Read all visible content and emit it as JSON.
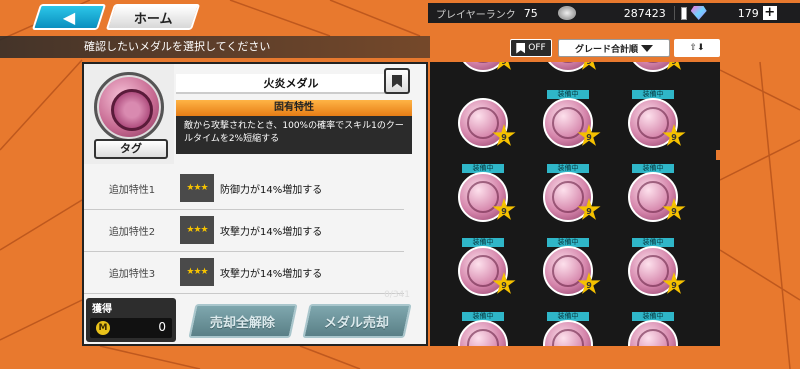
{
  "header": {
    "back_arrow": "◀",
    "home_label": "ホーム"
  },
  "status": {
    "rank_label": "プレイヤーランク",
    "rank_value": "75",
    "coins": "287423",
    "gems": "179",
    "plus": "+"
  },
  "instruction": "確認したいメダルを選択してください",
  "controls": {
    "bookmark_filter": "OFF",
    "sort_label": "グレード合計順",
    "order_toggle": "⇧⬇"
  },
  "medal": {
    "name": "火炎メダル",
    "tag_label": "タグ",
    "unique_header": "固有特性",
    "unique_desc": "敵から攻撃されたとき、100%の確率でスキル1のクールタイムを2%短縮する",
    "traits": [
      {
        "label": "追加特性1",
        "stars": "★★★",
        "text": "防御力が14%増加する"
      },
      {
        "label": "追加特性2",
        "stars": "★★★",
        "text": "攻撃力が14%増加する"
      },
      {
        "label": "追加特性3",
        "stars": "★★★",
        "text": "攻撃力が14%増加する"
      }
    ]
  },
  "bottom": {
    "owned_title": "獲得",
    "coin_letter": "M",
    "owned_value": "0",
    "count": "0/341",
    "unsell_label": "売却全解除",
    "sell_label": "メダル売却"
  },
  "grid": {
    "equip_label": "装備中",
    "grade": "9",
    "cells": [
      {
        "equipped": false
      },
      {
        "equipped": false
      },
      {
        "equipped": false
      },
      {
        "equipped": false
      },
      {
        "equipped": true
      },
      {
        "equipped": true
      },
      {
        "equipped": true
      },
      {
        "equipped": true
      },
      {
        "equipped": true
      },
      {
        "equipped": true
      },
      {
        "equipped": true
      },
      {
        "equipped": true
      },
      {
        "equipped": true
      },
      {
        "equipped": true
      },
      {
        "equipped": true
      }
    ]
  }
}
